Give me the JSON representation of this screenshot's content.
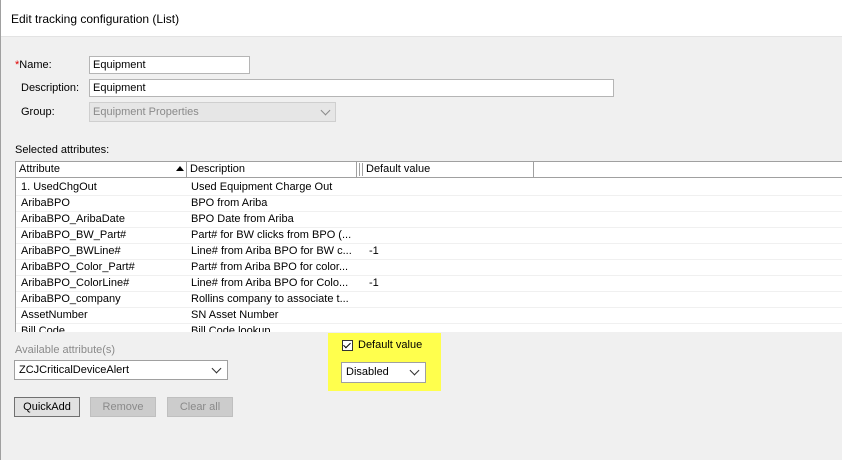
{
  "window": {
    "title": "Edit tracking configuration (List)"
  },
  "form": {
    "name_required_mark": "*",
    "name_label": "Name:",
    "name_value": "Equipment",
    "description_label": "Description:",
    "description_value": "Equipment",
    "group_label": "Group:",
    "group_value": "Equipment Properties"
  },
  "selected_attributes": {
    "label": "Selected attributes:",
    "columns": [
      "Attribute",
      "Description",
      "Default value"
    ],
    "rows": [
      {
        "attribute": "1. UsedChgOut",
        "description": "Used Equipment Charge Out",
        "default": ""
      },
      {
        "attribute": "AribaBPO",
        "description": "BPO from Ariba",
        "default": ""
      },
      {
        "attribute": "AribaBPO_AribaDate",
        "description": "BPO Date from Ariba",
        "default": ""
      },
      {
        "attribute": "AribaBPO_BW_Part#",
        "description": "Part# for BW clicks from BPO (...",
        "default": ""
      },
      {
        "attribute": "AribaBPO_BWLine#",
        "description": "Line# from Ariba BPO for BW c...",
        "default": "-1"
      },
      {
        "attribute": "AribaBPO_Color_Part#",
        "description": "Part# from Ariba BPO for color...",
        "default": ""
      },
      {
        "attribute": "AribaBPO_ColorLine#",
        "description": "Line# from Ariba BPO for Colo...",
        "default": "-1"
      },
      {
        "attribute": "AribaBPO_company",
        "description": "Rollins company to associate t...",
        "default": ""
      },
      {
        "attribute": "AssetNumber",
        "description": "SN Asset Number",
        "default": ""
      },
      {
        "attribute": "Bill Code",
        "description": "Bill Code lookup",
        "default": ""
      }
    ]
  },
  "available": {
    "label": "Available attribute(s)",
    "selected": "ZCJCriticalDeviceAlert"
  },
  "default_value": {
    "checkbox_label": "Default value",
    "checked": true,
    "selected": "Disabled",
    "highlight_color": "#ffff4d"
  },
  "buttons": {
    "quickadd": "QuickAdd",
    "remove": "Remove",
    "clear_all": "Clear all"
  }
}
